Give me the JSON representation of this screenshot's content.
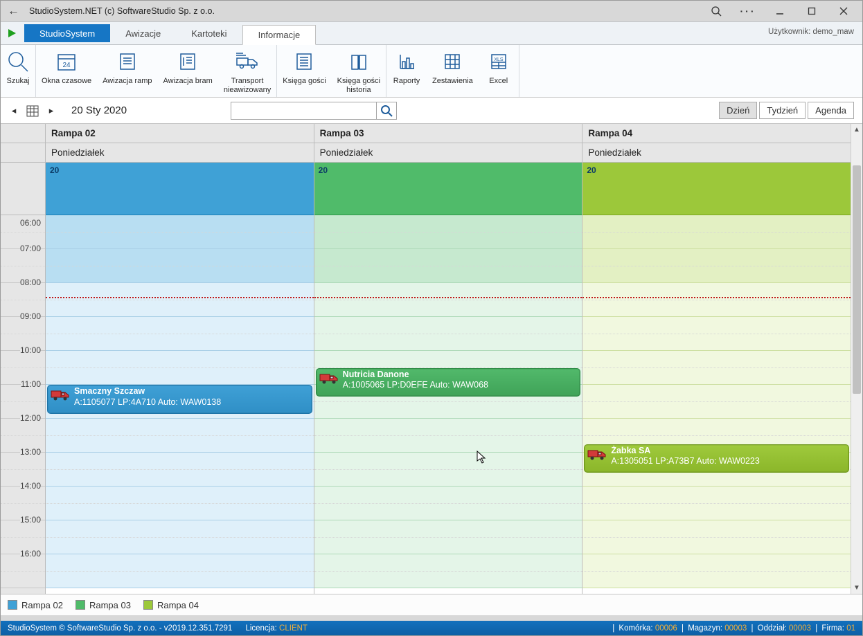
{
  "window": {
    "title": "StudioSystem.NET (c) SoftwareStudio Sp. z o.o."
  },
  "tabs": {
    "primary": "StudioSystem",
    "items": [
      "Awizacje",
      "Kartoteki",
      "Informacje"
    ],
    "user_label": "Użytkownik:",
    "user_value": "demo_maw"
  },
  "ribbon": {
    "g1": [
      {
        "label": "Szukaj"
      }
    ],
    "g2": [
      {
        "label": "Okna czasowe"
      },
      {
        "label": "Awizacja ramp"
      },
      {
        "label": "Awizacja bram"
      },
      {
        "label": "Transport\nnieawizowany"
      }
    ],
    "g3": [
      {
        "label": "Księga gości"
      },
      {
        "label": "Księga gości\nhistoria"
      }
    ],
    "g4": [
      {
        "label": "Raporty"
      },
      {
        "label": "Zestawienia"
      },
      {
        "label": "Excel"
      }
    ]
  },
  "nav": {
    "date_label": "20 Sty 2020",
    "search_placeholder": "",
    "views": [
      "Dzień",
      "Tydzień",
      "Agenda"
    ],
    "active_view": "Dzień"
  },
  "scheduler": {
    "day_name": "Poniedziałek",
    "day_number": "20",
    "columns": [
      {
        "name": "Rampa 02"
      },
      {
        "name": "Rampa 03"
      },
      {
        "name": "Rampa 04"
      }
    ],
    "hours": [
      "06:00",
      "07:00",
      "08:00",
      "09:00",
      "10:00",
      "11:00",
      "12:00",
      "13:00",
      "14:00",
      "15:00",
      "16:00"
    ],
    "events": [
      {
        "col": 0,
        "css": "ev-blue",
        "top_hour": "11:00",
        "height_hours": 0.85,
        "title": "Smaczny Szczaw",
        "detail": "A:1105077 LP:4A710 Auto: WAW0138"
      },
      {
        "col": 1,
        "css": "ev-green",
        "top_hour": "10:30",
        "height_hours": 0.85,
        "title": "Nutricia Danone",
        "detail": "A:1005065 LP:D0EFE Auto: WAW068"
      },
      {
        "col": 2,
        "css": "ev-lime",
        "top_hour": "12:45",
        "height_hours": 0.85,
        "title": "Żabka SA",
        "detail": "A:1305051 LP:A73B7 Auto: WAW0223"
      }
    ],
    "now_line_hour": "08:25"
  },
  "legend": {
    "items": [
      "Rampa 02",
      "Rampa 03",
      "Rampa 04"
    ]
  },
  "status": {
    "left_text": "StudioSystem © SoftwareStudio Sp. z o.o. - v2019.12.351.7291",
    "license_label": "Licencja:",
    "license_value": "CLIENT",
    "right": [
      {
        "label": "Komórka:",
        "value": "00006"
      },
      {
        "label": "Magazyn:",
        "value": "00003"
      },
      {
        "label": "Oddział:",
        "value": "00003"
      },
      {
        "label": "Firma:",
        "value": "01"
      }
    ]
  }
}
